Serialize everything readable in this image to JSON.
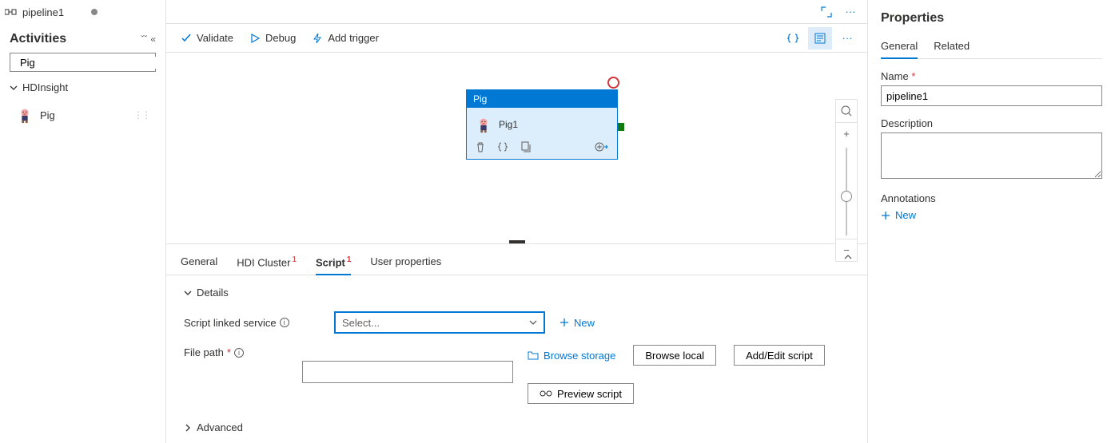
{
  "pipeline": {
    "name": "pipeline1"
  },
  "sidebar": {
    "title": "Activities",
    "search_value": "Pig",
    "section_label": "HDInsight",
    "item_label": "Pig"
  },
  "actionbar": {
    "validate": "Validate",
    "debug": "Debug",
    "add_trigger": "Add trigger"
  },
  "node": {
    "type_label": "Pig",
    "name": "Pig1"
  },
  "config": {
    "tabs": {
      "general": "General",
      "hdi": "HDI Cluster",
      "hdi_sup": "1",
      "script": "Script",
      "script_sup": "1",
      "user_props": "User properties"
    },
    "details_label": "Details",
    "linked_service_label": "Script linked service",
    "select_placeholder": "Select...",
    "new_label": "New",
    "file_path_label": "File path",
    "browse_storage": "Browse storage",
    "browse_local": "Browse local",
    "add_edit_script": "Add/Edit script",
    "preview_script": "Preview script",
    "advanced_label": "Advanced"
  },
  "props": {
    "title": "Properties",
    "tab_general": "General",
    "tab_related": "Related",
    "name_label": "Name",
    "name_value": "pipeline1",
    "description_label": "Description",
    "description_value": "",
    "annotations_label": "Annotations",
    "new_label": "New"
  }
}
